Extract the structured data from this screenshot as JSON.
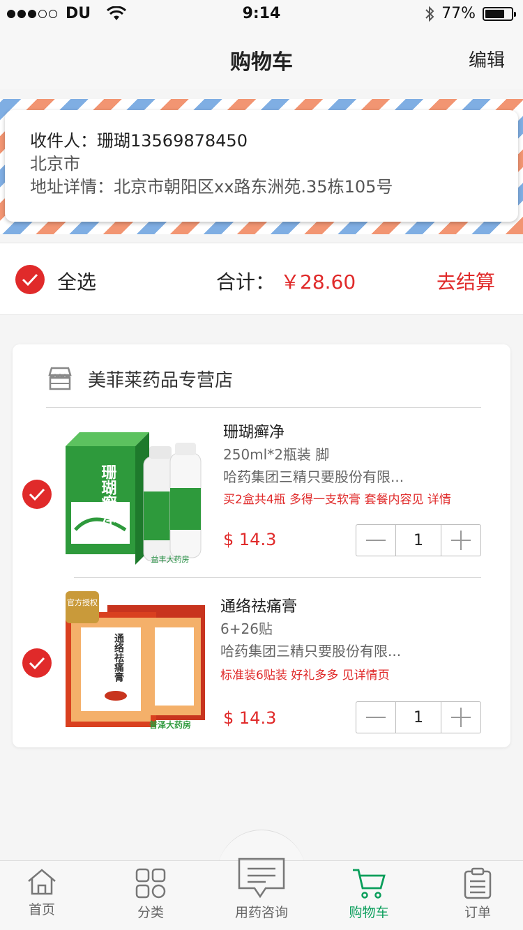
{
  "status_bar": {
    "carrier": "DU",
    "time": "9:14",
    "battery": "77%"
  },
  "nav": {
    "title": "购物车",
    "edit": "编辑"
  },
  "address": {
    "recipient": "收件人：珊瑚13569878450",
    "city": "北京市",
    "detail": "地址详情：北京市朝阳区xx路东洲苑.35栋105号"
  },
  "summary": {
    "select_all": "全选",
    "total_label": "合计：",
    "total_value": "￥28.60",
    "checkout": "去结算"
  },
  "store": {
    "name": "美菲莱药品专营店"
  },
  "items": [
    {
      "title": "珊瑚癣净",
      "spec": "250ml*2瓶装 脚",
      "maker": "哈药集团三精只要股份有限...",
      "promo": "买2盒共4瓶 多得一支软膏 套餐内容见 详情",
      "price": "$ 14.3",
      "quantity": "1",
      "image_text": "珊瑚癣净",
      "image_brand": "益丰大药房"
    },
    {
      "title": "通络祛痛膏",
      "spec": "6+26贴",
      "maker": "哈药集团三精只要股份有限...",
      "promo": "标准装6贴装 好礼多多 见详情页",
      "price": "$ 14.3",
      "quantity": "1",
      "image_text": "通络祛痛膏",
      "image_badge": "官方授权",
      "image_brand": "普泽大药房"
    }
  ],
  "tabs": [
    {
      "label": "首页",
      "icon": "home-icon"
    },
    {
      "label": "分类",
      "icon": "grid-icon"
    },
    {
      "label": "用药咨询",
      "icon": "chat-icon"
    },
    {
      "label": "购物车",
      "icon": "cart-icon",
      "active": true
    },
    {
      "label": "订单",
      "icon": "clipboard-icon"
    }
  ],
  "colors": {
    "accent_red": "#e02a2a",
    "active_green": "#0a9e5b"
  }
}
